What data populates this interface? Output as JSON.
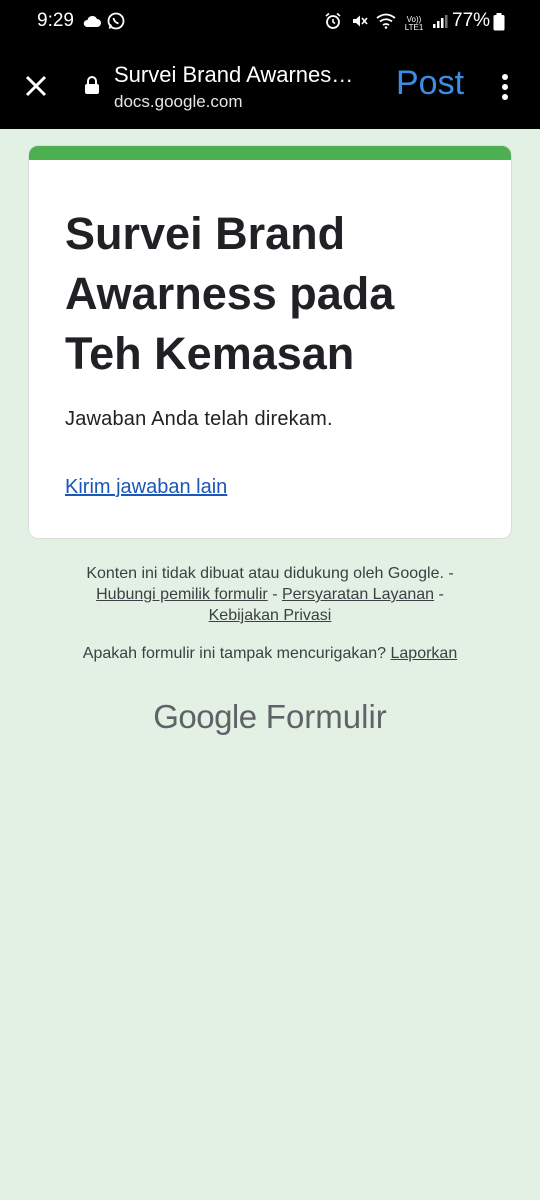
{
  "status_bar": {
    "time": "9:29",
    "battery_percent": "77%",
    "left_icons": [
      "cloud-icon",
      "whatsapp-icon"
    ],
    "right_icons": [
      "alarm-icon",
      "mute-icon",
      "wifi-icon",
      "volte-icon",
      "signal-icon",
      "battery-icon"
    ],
    "volte_label": "Vo)) LTE1"
  },
  "browser": {
    "title": "Survei Brand Awarnes…",
    "url": "docs.google.com",
    "post_label": "Post"
  },
  "form": {
    "title": "Survei Brand Awarness pada Teh Kemasan",
    "response_message": "Jawaban Anda telah direkam.",
    "resend_link": "Kirim jawaban lain",
    "accent_color": "#4caf50"
  },
  "footer": {
    "disclaimer": "Konten ini tidak dibuat atau didukung oleh Google. -",
    "contact_owner": "Hubungi pemilik formulir",
    "sep1": " - ",
    "terms": "Persyaratan Layanan",
    "sep2": " -",
    "privacy": "Kebijakan Privasi",
    "suspicious_question": "Apakah formulir ini tampak mencurigakan?",
    "report_link": "Laporkan",
    "brand_google": "Google",
    "brand_product": "Formulir"
  }
}
